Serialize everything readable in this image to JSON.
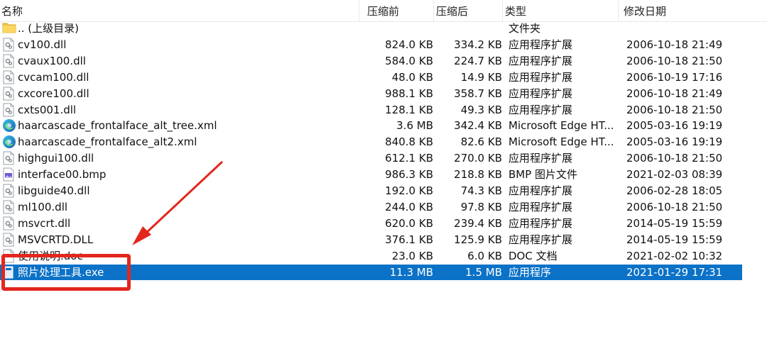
{
  "columns": {
    "name": "名称",
    "compressed": "压缩前",
    "zipped": "压缩后",
    "type": "类型",
    "modified": "修改日期"
  },
  "rows": [
    {
      "name": ".. (上级目录)",
      "compressed": "",
      "zipped": "",
      "type": "文件夹",
      "modified": "",
      "icon": "folder-icon"
    },
    {
      "name": "cv100.dll",
      "compressed": "824.0 KB",
      "zipped": "334.2 KB",
      "type": "应用程序扩展",
      "modified": "2006-10-18 21:49",
      "icon": "dll-file-icon"
    },
    {
      "name": "cvaux100.dll",
      "compressed": "584.0 KB",
      "zipped": "224.7 KB",
      "type": "应用程序扩展",
      "modified": "2006-10-18 21:50",
      "icon": "dll-file-icon"
    },
    {
      "name": "cvcam100.dll",
      "compressed": "48.0 KB",
      "zipped": "14.9 KB",
      "type": "应用程序扩展",
      "modified": "2006-10-19 17:16",
      "icon": "dll-file-icon"
    },
    {
      "name": "cxcore100.dll",
      "compressed": "988.1 KB",
      "zipped": "358.7 KB",
      "type": "应用程序扩展",
      "modified": "2006-10-18 21:49",
      "icon": "dll-file-icon"
    },
    {
      "name": "cxts001.dll",
      "compressed": "128.1 KB",
      "zipped": "49.3 KB",
      "type": "应用程序扩展",
      "modified": "2006-10-18 21:50",
      "icon": "dll-file-icon"
    },
    {
      "name": "haarcascade_frontalface_alt_tree.xml",
      "compressed": "3.6 MB",
      "zipped": "342.4 KB",
      "type": "Microsoft Edge HT...",
      "modified": "2005-03-16 19:19",
      "icon": "edge-icon"
    },
    {
      "name": "haarcascade_frontalface_alt2.xml",
      "compressed": "840.8 KB",
      "zipped": "82.6 KB",
      "type": "Microsoft Edge HT...",
      "modified": "2005-03-16 19:19",
      "icon": "edge-icon"
    },
    {
      "name": "highgui100.dll",
      "compressed": "612.1 KB",
      "zipped": "270.0 KB",
      "type": "应用程序扩展",
      "modified": "2006-10-18 21:50",
      "icon": "dll-file-icon"
    },
    {
      "name": "interface00.bmp",
      "compressed": "986.3 KB",
      "zipped": "218.8 KB",
      "type": "BMP 图片文件",
      "modified": "2021-02-03 08:39",
      "icon": "image-file-icon"
    },
    {
      "name": "libguide40.dll",
      "compressed": "192.0 KB",
      "zipped": "74.3 KB",
      "type": "应用程序扩展",
      "modified": "2006-02-28 18:05",
      "icon": "dll-file-icon"
    },
    {
      "name": "ml100.dll",
      "compressed": "244.0 KB",
      "zipped": "97.8 KB",
      "type": "应用程序扩展",
      "modified": "2006-10-18 21:50",
      "icon": "dll-file-icon"
    },
    {
      "name": "msvcrt.dll",
      "compressed": "620.0 KB",
      "zipped": "239.4 KB",
      "type": "应用程序扩展",
      "modified": "2014-05-19 15:59",
      "icon": "dll-file-icon"
    },
    {
      "name": "MSVCRTD.DLL",
      "compressed": "376.1 KB",
      "zipped": "125.9 KB",
      "type": "应用程序扩展",
      "modified": "2014-05-19 15:59",
      "icon": "dll-file-icon"
    },
    {
      "name": "使用说明.doc",
      "compressed": "23.0 KB",
      "zipped": "6.0 KB",
      "type": "DOC 文档",
      "modified": "2021-02-02 10:32",
      "icon": "doc-file-icon"
    },
    {
      "name": "照片处理工具.exe",
      "compressed": "11.3 MB",
      "zipped": "1.5 MB",
      "type": "应用程序",
      "modified": "2021-01-29 17:31",
      "icon": "exe-file-icon",
      "selected": true
    }
  ],
  "colors": {
    "selection": "#0b72c7",
    "annotation": "#e3261e",
    "folder": "#f5c542"
  }
}
